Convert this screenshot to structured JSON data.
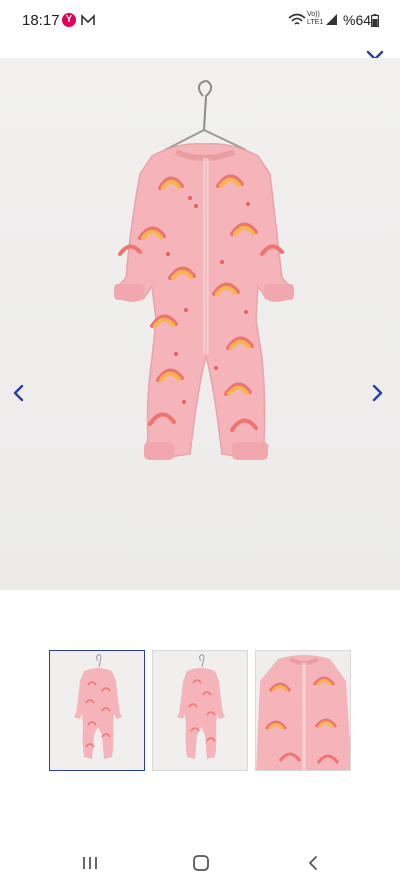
{
  "status_bar": {
    "time": "18:17",
    "app_badge": "Y",
    "volte_top": "Vo))",
    "volte_bottom": "LTE1",
    "battery": "%64"
  },
  "colors": {
    "accent": "#2a3fa6",
    "garment_pink": "#f4b4b9",
    "badge": "#e0005a"
  },
  "gallery": {
    "close_icon": "close-icon",
    "prev_icon": "chevron-left-icon",
    "next_icon": "chevron-right-icon",
    "thumbnails": [
      {
        "view": "front",
        "selected": true
      },
      {
        "view": "front-alt",
        "selected": false
      },
      {
        "view": "detail",
        "selected": false
      }
    ]
  },
  "nav_bar": {
    "icons": [
      "recents-icon",
      "home-icon",
      "back-icon"
    ]
  }
}
